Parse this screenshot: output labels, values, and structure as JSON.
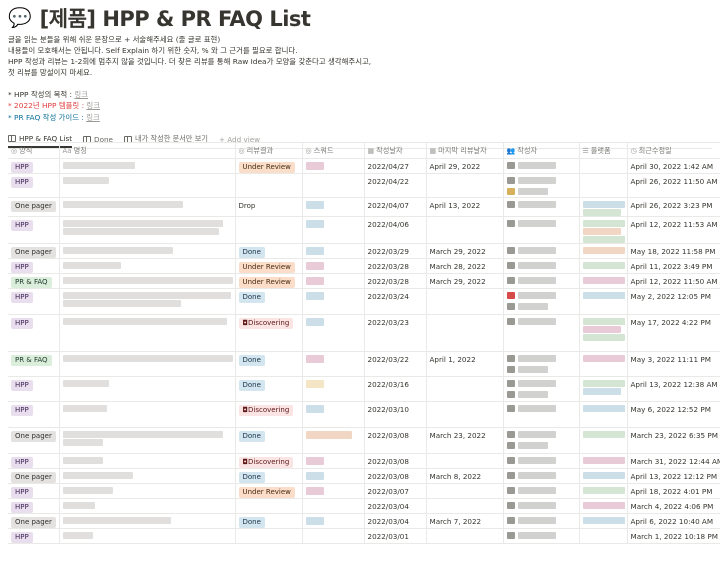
{
  "page": {
    "icon": "speech-bubble-icon",
    "icon_glyph": "💬",
    "title": "[제품] HPP & PR FAQ List"
  },
  "description": {
    "lines": [
      "글을 읽는 분들을 위해 쉬운 문장으로 + 서술해주세요 (줄 글로 표현)",
      "내용들이 모호해서는 안됩니다. Self Explain 하기 위한 숫자, % 와 그 근거를 필요로 합니다.",
      "HPP 작성과 리뷰는 1-2회에 멈추지 않을 것입니다. 더 찾은 리뷰를 통해 Raw Idea가 모양을 갖춘다고 생각해주시고,",
      "첫 리뷰를 망설이지 마세요."
    ],
    "links": [
      {
        "prefix": "* HPP 작성의 목적 : ",
        "link": "링크",
        "color": "default"
      },
      {
        "prefix": "* 2022년 HPP 템플릿 : ",
        "link": "링크",
        "color": "red"
      },
      {
        "prefix": "* PR FAQ 작성 가이드 : ",
        "link": "링크",
        "color": "blue"
      }
    ]
  },
  "views": [
    {
      "label": "HPP & FAQ List",
      "active": true
    },
    {
      "label": "Done",
      "active": false
    },
    {
      "label": "내가 작성한 문서만 보기",
      "active": false
    }
  ],
  "add_view_label": "+ Add view",
  "columns": {
    "type": "양식",
    "name": "명칭",
    "result": "리뷰결과",
    "squad": "스쿼드",
    "created": "작성날자",
    "last_review": "마지막 리뷰날자",
    "author": "작성자",
    "platform": "플랫폼",
    "modified": "최근수정일"
  },
  "column_icons": {
    "type": "◎",
    "name": "Aa",
    "result": "◎",
    "squad": "◎",
    "created": "▦",
    "last_review": "▦",
    "author": "👥",
    "platform": "☰",
    "modified": "◷"
  },
  "rows": [
    {
      "type": "HPP",
      "result": "Under Review",
      "created": "2022/04/27",
      "last_review": "April 29, 2022",
      "modified": "April 30, 2022 1:42 AM"
    },
    {
      "type": "HPP",
      "result": "",
      "created": "2022/04/22",
      "last_review": "",
      "modified": "April 26, 2022 11:50 AM"
    },
    {
      "type": "One pager",
      "result": "Drop",
      "created": "2022/04/07",
      "last_review": "April 13, 2022",
      "modified": "April 26, 2022 3:23 PM"
    },
    {
      "type": "HPP",
      "result": "",
      "created": "2022/04/06",
      "last_review": "",
      "modified": "April 12, 2022 11:53 AM"
    },
    {
      "type": "One pager",
      "result": "Done",
      "created": "2022/03/29",
      "last_review": "March 29, 2022",
      "modified": "May 18, 2022 11:58 PM"
    },
    {
      "type": "HPP",
      "result": "Under Review",
      "created": "2022/03/28",
      "last_review": "March 28, 2022",
      "modified": "April 11, 2022 3:49 PM"
    },
    {
      "type": "PR & FAQ",
      "result": "Under Review",
      "created": "2022/03/28",
      "last_review": "March 29, 2022",
      "modified": "April 12, 2022 11:50 AM"
    },
    {
      "type": "HPP",
      "result": "Done",
      "created": "2022/03/24",
      "last_review": "",
      "modified": "May 2, 2022 12:05 PM"
    },
    {
      "type": "HPP",
      "result": "Discovering",
      "created": "2022/03/23",
      "last_review": "",
      "modified": "May 17, 2022 4:22 PM"
    },
    {
      "type": "PR & FAQ",
      "result": "Done",
      "created": "2022/03/22",
      "last_review": "April 1, 2022",
      "modified": "May 3, 2022 11:11 PM"
    },
    {
      "type": "HPP",
      "result": "Done",
      "created": "2022/03/16",
      "last_review": "",
      "modified": "April 13, 2022 12:38 AM"
    },
    {
      "type": "HPP",
      "result": "Discovering",
      "created": "2022/03/10",
      "last_review": "",
      "modified": "May 6, 2022 12:52 PM"
    },
    {
      "type": "One pager",
      "result": "Done",
      "created": "2022/03/08",
      "last_review": "March 23, 2022",
      "modified": "March 23, 2022 6:35 PM"
    },
    {
      "type": "HPP",
      "result": "Discovering",
      "created": "2022/03/08",
      "last_review": "",
      "modified": "March 31, 2022 12:44 AM"
    },
    {
      "type": "One pager",
      "result": "Done",
      "created": "2022/03/08",
      "last_review": "March 8, 2022",
      "modified": "April 13, 2022 12:12 PM"
    },
    {
      "type": "HPP",
      "result": "Under Review",
      "created": "2022/03/07",
      "last_review": "",
      "modified": "April 18, 2022 4:01 PM"
    },
    {
      "type": "HPP",
      "result": "",
      "created": "2022/03/04",
      "last_review": "",
      "modified": "March 4, 2022 4:06 PM"
    },
    {
      "type": "One pager",
      "result": "Done",
      "created": "2022/03/04",
      "last_review": "March 7, 2022",
      "modified": "April 6, 2022 10:40 AM"
    },
    {
      "type": "HPP",
      "result": "",
      "created": "2022/03/01",
      "last_review": "",
      "modified": "March 1, 2022 10:18 PM"
    }
  ],
  "tag_colors": {
    "HPP": "#e8deee",
    "One pager": "#e3e2e0",
    "PR & FAQ": "#dbeddb",
    "Under Review": "#fadec9",
    "Done": "#d3e5ef",
    "Discovering": "#fbe4e4"
  }
}
